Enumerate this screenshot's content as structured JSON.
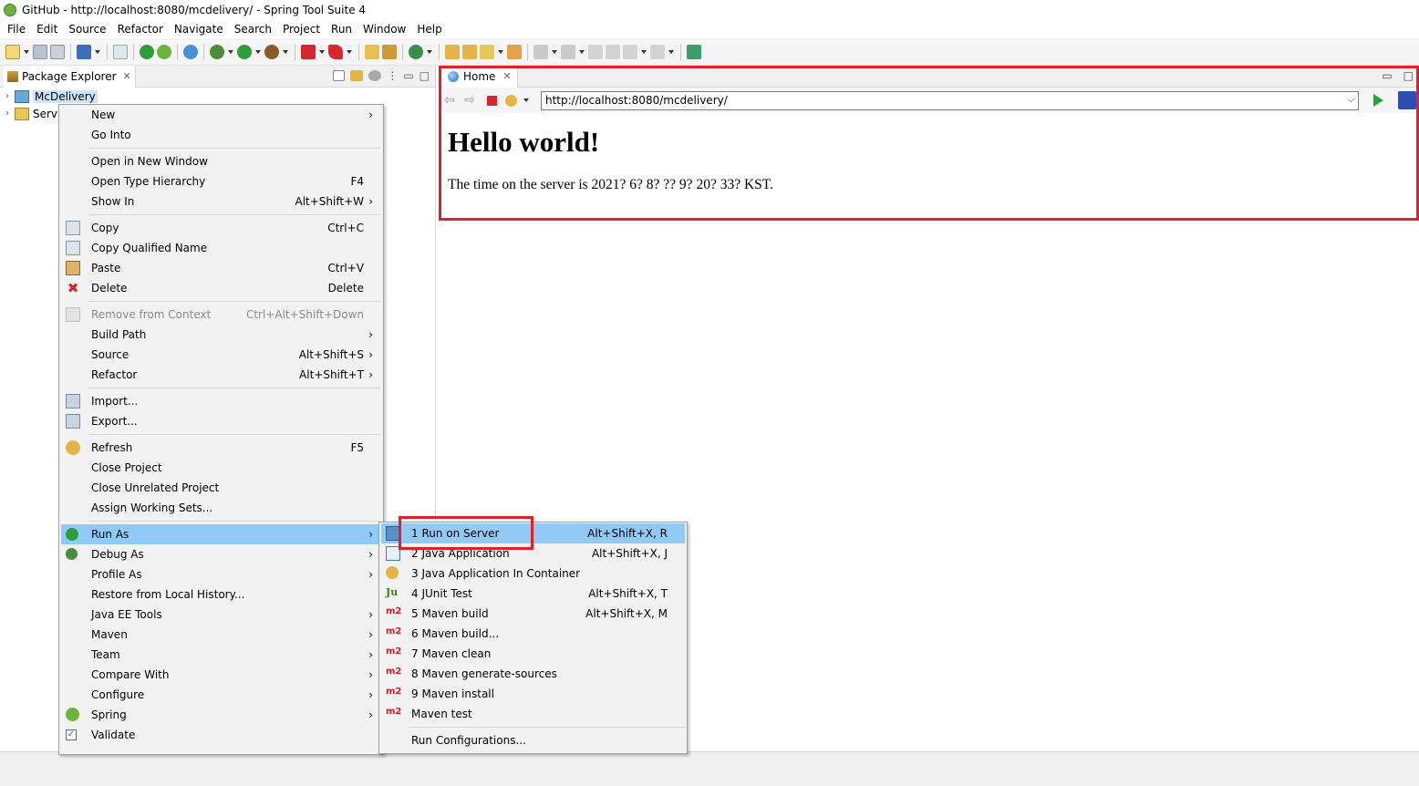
{
  "window": {
    "title": "GitHub - http://localhost:8080/mcdelivery/ - Spring Tool Suite 4"
  },
  "menubar": [
    "File",
    "Edit",
    "Source",
    "Refactor",
    "Navigate",
    "Search",
    "Project",
    "Run",
    "Window",
    "Help"
  ],
  "package_explorer": {
    "tab_label": "Package Explorer",
    "tree": [
      {
        "label": "McDelivery",
        "selected": true
      },
      {
        "label": "Serv",
        "selected": false
      }
    ]
  },
  "browser": {
    "tab_label": "Home",
    "url": "http://localhost:8080/mcdelivery/",
    "page": {
      "heading": "Hello world!",
      "text": "The time on the server is 2021? 6? 8? ?? 9? 20? 33? KST."
    }
  },
  "context_menu": {
    "items": [
      {
        "label": "New",
        "shortcut": "",
        "submenu": true
      },
      {
        "label": "Go Into",
        "shortcut": ""
      },
      {
        "label": "Open in New Window",
        "shortcut": ""
      },
      {
        "label": "Open Type Hierarchy",
        "shortcut": "F4"
      },
      {
        "label": "Show In",
        "shortcut": "Alt+Shift+W",
        "submenu": true
      },
      {
        "label": "Copy",
        "shortcut": "Ctrl+C",
        "icon": "copy-icon"
      },
      {
        "label": "Copy Qualified Name",
        "shortcut": "",
        "icon": "copy-qualified-icon"
      },
      {
        "label": "Paste",
        "shortcut": "Ctrl+V",
        "icon": "paste-icon"
      },
      {
        "label": "Delete",
        "shortcut": "Delete",
        "icon": "delete-icon"
      },
      {
        "label": "Remove from Context",
        "shortcut": "Ctrl+Alt+Shift+Down",
        "disabled": true,
        "icon": "remove-context-icon"
      },
      {
        "label": "Build Path",
        "shortcut": "",
        "submenu": true
      },
      {
        "label": "Source",
        "shortcut": "Alt+Shift+S",
        "submenu": true
      },
      {
        "label": "Refactor",
        "shortcut": "Alt+Shift+T",
        "submenu": true
      },
      {
        "label": "Import...",
        "shortcut": "",
        "icon": "import-icon"
      },
      {
        "label": "Export...",
        "shortcut": "",
        "icon": "export-icon"
      },
      {
        "label": "Refresh",
        "shortcut": "F5",
        "icon": "refresh-icon"
      },
      {
        "label": "Close Project",
        "shortcut": ""
      },
      {
        "label": "Close Unrelated Project",
        "shortcut": ""
      },
      {
        "label": "Assign Working Sets...",
        "shortcut": ""
      },
      {
        "label": "Run As",
        "shortcut": "",
        "submenu": true,
        "active": true,
        "icon": "run-icon"
      },
      {
        "label": "Debug As",
        "shortcut": "",
        "submenu": true,
        "icon": "debug-icon"
      },
      {
        "label": "Profile As",
        "shortcut": "",
        "submenu": true
      },
      {
        "label": "Restore from Local History...",
        "shortcut": ""
      },
      {
        "label": "Java EE Tools",
        "shortcut": "",
        "submenu": true
      },
      {
        "label": "Maven",
        "shortcut": "",
        "submenu": true
      },
      {
        "label": "Team",
        "shortcut": "",
        "submenu": true
      },
      {
        "label": "Compare With",
        "shortcut": "",
        "submenu": true
      },
      {
        "label": "Configure",
        "shortcut": "",
        "submenu": true
      },
      {
        "label": "Spring",
        "shortcut": "",
        "submenu": true,
        "icon": "spring-icon"
      },
      {
        "label": "Validate",
        "shortcut": "",
        "icon": "validate-checkbox-icon"
      }
    ]
  },
  "run_as_submenu": {
    "items": [
      {
        "label": "1 Run on Server",
        "shortcut": "Alt+Shift+X, R",
        "active": true,
        "icon": "server-run-icon"
      },
      {
        "label": "2 Java Application",
        "shortcut": "Alt+Shift+X, J",
        "icon": "java-app-icon"
      },
      {
        "label": "3 Java Application In Container",
        "shortcut": "",
        "icon": "container-icon"
      },
      {
        "label": "4 JUnit Test",
        "shortcut": "Alt+Shift+X, T",
        "icon": "junit-icon",
        "icon_text": "Ju"
      },
      {
        "label": "5 Maven build",
        "shortcut": "Alt+Shift+X, M",
        "icon": "maven-icon",
        "icon_text": "m2"
      },
      {
        "label": "6 Maven build...",
        "shortcut": "",
        "icon": "maven-icon",
        "icon_text": "m2"
      },
      {
        "label": "7 Maven clean",
        "shortcut": "",
        "icon": "maven-icon",
        "icon_text": "m2"
      },
      {
        "label": "8 Maven generate-sources",
        "shortcut": "",
        "icon": "maven-icon",
        "icon_text": "m2"
      },
      {
        "label": "9 Maven install",
        "shortcut": "",
        "icon": "maven-icon",
        "icon_text": "m2"
      },
      {
        "label": "Maven test",
        "shortcut": "",
        "icon": "maven-icon",
        "icon_text": "m2"
      },
      {
        "label": "Run Configurations...",
        "shortcut": ""
      }
    ]
  },
  "colors": {
    "highlight_red": "#e0202a",
    "menu_active": "#91c9f7",
    "selection": "#cce4f7"
  }
}
